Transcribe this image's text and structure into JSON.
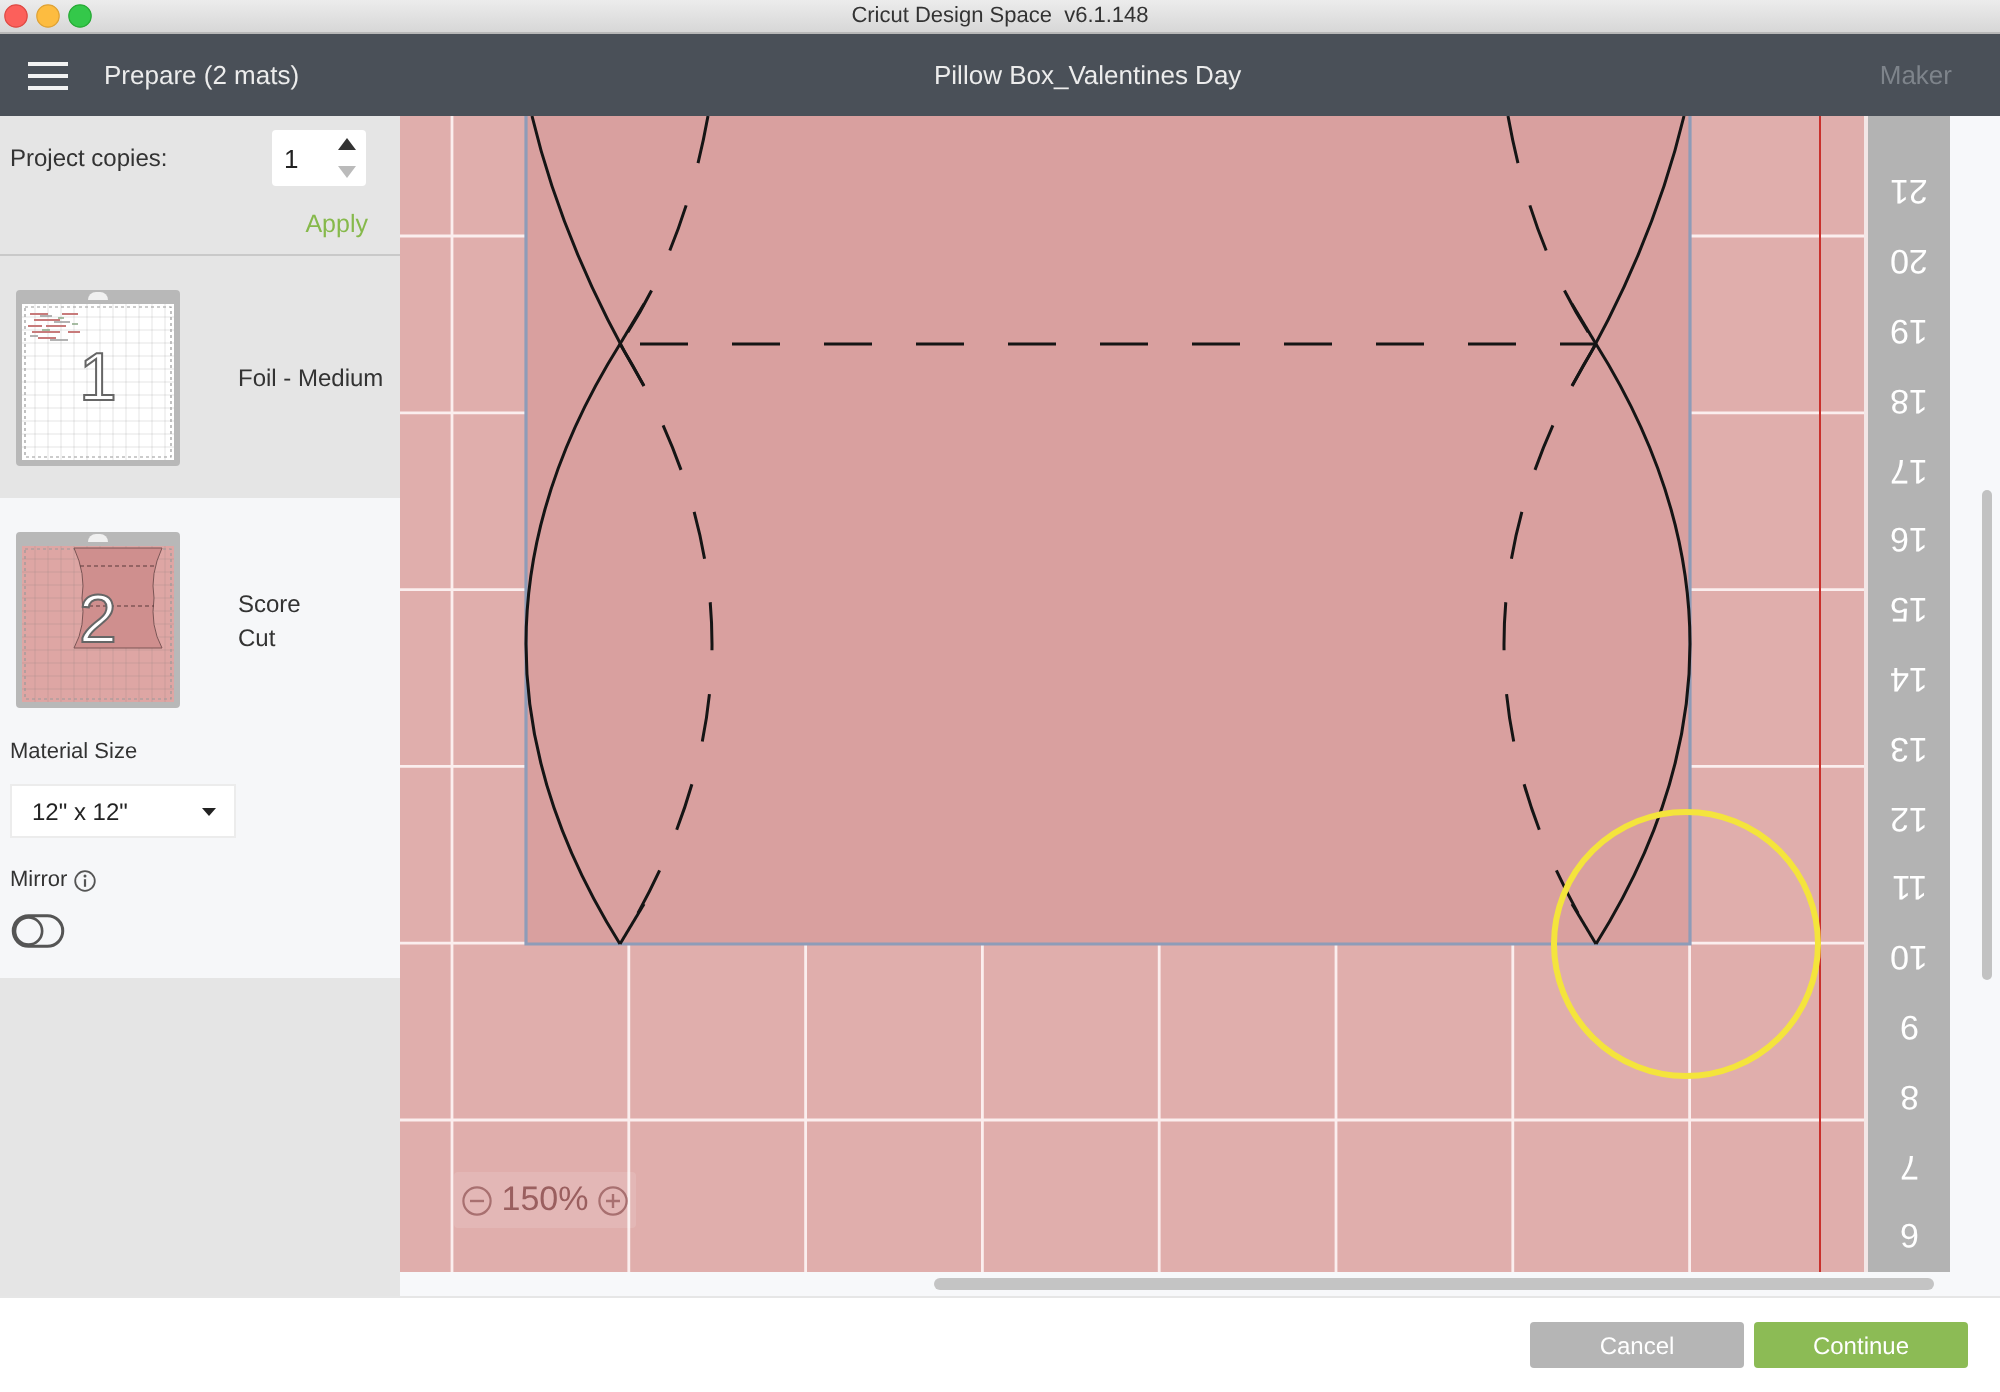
{
  "window": {
    "title": "Cricut Design Space  v6.1.148"
  },
  "header": {
    "title": "Prepare (2 mats)",
    "project_name": "Pillow Box_Valentines Day",
    "machine": {
      "label": "Maker",
      "disabled": true
    }
  },
  "sidebar": {
    "project_copies": {
      "label": "Project copies:",
      "value": "1"
    },
    "apply": "Apply",
    "mats": [
      {
        "number": "1",
        "kind": "foil",
        "color": "#ffffff",
        "operations": [
          "Foil - Medium"
        ],
        "selected": false
      },
      {
        "number": "2",
        "kind": "pillow",
        "color": "#dea6a4",
        "operations": [
          "Score",
          "Cut"
        ],
        "selected": true,
        "material_size": {
          "label": "Material Size",
          "value": "12\" x 12\""
        },
        "mirror": {
          "label": "Mirror",
          "on": false
        }
      }
    ]
  },
  "canvas": {
    "zoom": "150%",
    "ruler": [
      "21",
      "20",
      "19",
      "18",
      "17",
      "16",
      "15",
      "14",
      "13",
      "12",
      "11",
      "10",
      "9",
      "8",
      "7",
      "6"
    ]
  },
  "buttons": [
    {
      "label": "Cancel",
      "kind": "secondary"
    },
    {
      "label": "Continue",
      "kind": "primary"
    }
  ]
}
